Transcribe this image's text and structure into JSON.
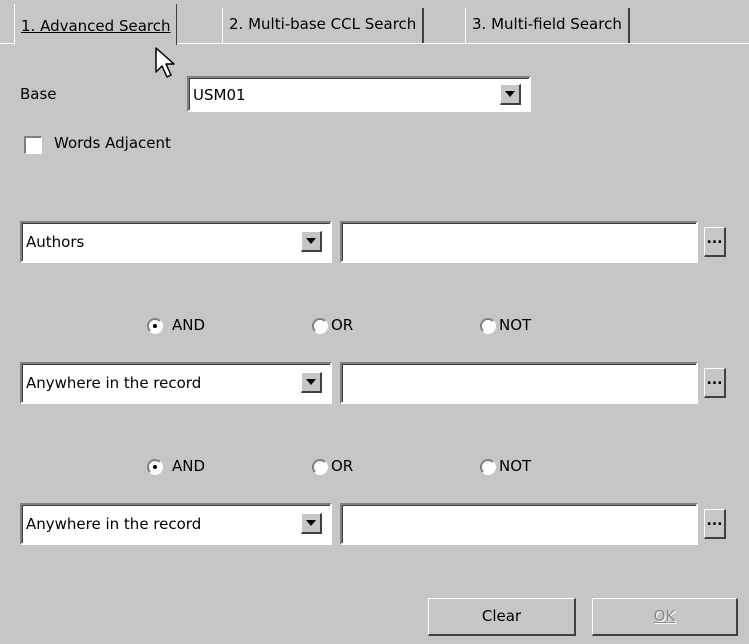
{
  "tabs": [
    {
      "label": "1. Advanced Search",
      "active": true
    },
    {
      "label": "2. Multi-base CCL Search",
      "active": false
    },
    {
      "label": "3. Multi-field Search",
      "active": false
    }
  ],
  "base": {
    "label": "Base",
    "value": "USM01"
  },
  "words_adjacent": {
    "label": "Words Adjacent",
    "checked": false
  },
  "rows": [
    {
      "field": "Authors",
      "value": ""
    },
    {
      "field": "Anywhere in the record",
      "value": ""
    },
    {
      "field": "Anywhere in the record",
      "value": ""
    }
  ],
  "operators": [
    {
      "and": "AND",
      "or": "OR",
      "not": "NOT",
      "selected": "AND"
    },
    {
      "and": "AND",
      "or": "OR",
      "not": "NOT",
      "selected": "AND"
    }
  ],
  "browse_label": "...",
  "buttons": {
    "clear": "Clear",
    "ok": "OK"
  },
  "icons": {
    "cursor": "mouse-pointer-icon",
    "dropdown": "chevron-down-icon"
  }
}
